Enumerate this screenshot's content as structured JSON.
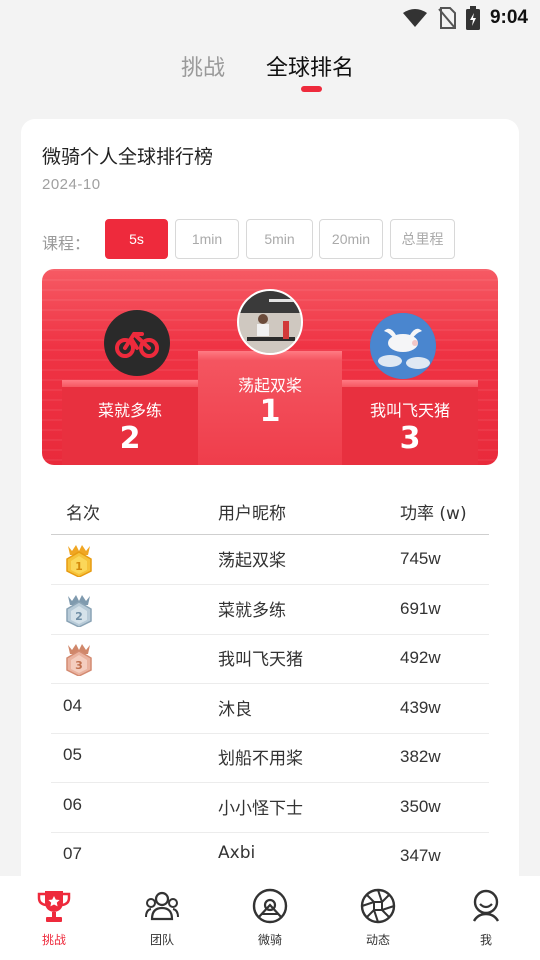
{
  "status_bar": {
    "time": "9:04",
    "icons": [
      "wifi-icon",
      "no-sim-icon",
      "battery-icon"
    ]
  },
  "top_tabs": [
    {
      "label": "挑战",
      "active": false
    },
    {
      "label": "全球排名",
      "active": true
    }
  ],
  "card": {
    "title": "微骑个人全球排行榜",
    "date": "2024-10",
    "course_label": "课程：",
    "courses": [
      {
        "label": "5s",
        "active": true
      },
      {
        "label": "1min",
        "active": false
      },
      {
        "label": "5min",
        "active": false
      },
      {
        "label": "20min",
        "active": false
      },
      {
        "label": "总里程",
        "active": false
      }
    ]
  },
  "podium": {
    "first": {
      "name": "荡起双桨",
      "rank": "1"
    },
    "second": {
      "name": "菜就多练",
      "rank": "2"
    },
    "third": {
      "name": "我叫飞天猪",
      "rank": "3"
    }
  },
  "table": {
    "headers": {
      "rank": "名次",
      "name": "用户昵称",
      "power": "功率 (w)"
    },
    "rows": [
      {
        "rank": "1",
        "name": "荡起双桨",
        "power": "745w",
        "medal": "gold"
      },
      {
        "rank": "2",
        "name": "菜就多练",
        "power": "691w",
        "medal": "silver"
      },
      {
        "rank": "3",
        "name": "我叫飞天猪",
        "power": "492w",
        "medal": "bronze"
      },
      {
        "rank": "04",
        "name": "沐良",
        "power": "439w"
      },
      {
        "rank": "05",
        "name": "划船不用桨",
        "power": "382w"
      },
      {
        "rank": "06",
        "name": "小小怪下士",
        "power": "350w"
      },
      {
        "rank": "07",
        "name": "Axbi",
        "power": "347w"
      }
    ]
  },
  "bottom_nav": [
    {
      "label": "挑战",
      "icon": "trophy-icon",
      "active": true
    },
    {
      "label": "团队",
      "icon": "team-icon",
      "active": false
    },
    {
      "label": "微骑",
      "icon": "ride-icon",
      "active": false
    },
    {
      "label": "动态",
      "icon": "aperture-icon",
      "active": false
    },
    {
      "label": "我",
      "icon": "profile-icon",
      "active": false
    }
  ],
  "colors": {
    "accent": "#ee2a3c",
    "text": "#222222",
    "muted": "#9a9a9a"
  }
}
